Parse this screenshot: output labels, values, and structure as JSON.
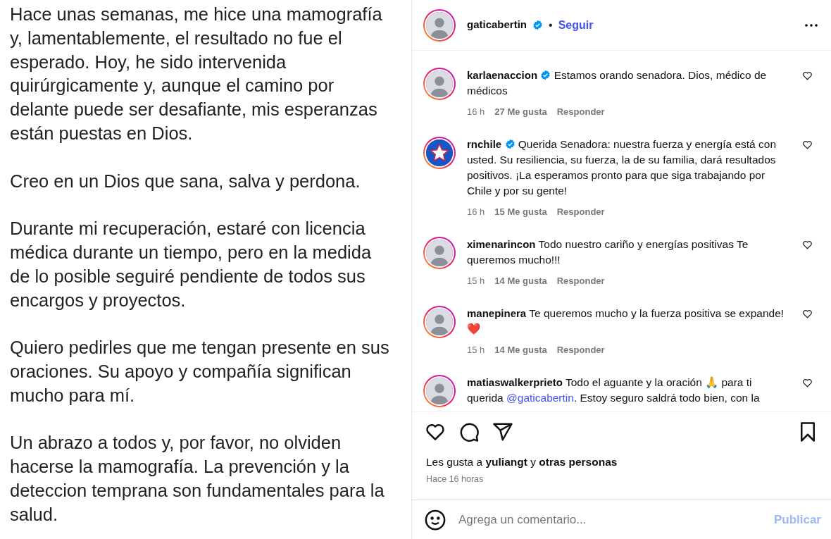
{
  "post_image": {
    "kind": "document",
    "paragraphs": [
      "Hace unas semanas, me hice una mamografía y, lamentablemente, el resultado no fue el esperado. Hoy, he sido intervenida quirúrgicamente y, aunque el camino por delante puede ser desafiante, mis esperanzas están puestas en Dios.",
      "Creo en un Dios que sana, salva y perdona.",
      "Durante mi recuperación, estaré con licencia médica durante un tiempo,  pero en la medida de lo posible seguiré pendiente de todos sus encargos y proyectos.",
      "Quiero pedirles que me tengan presente en sus oraciones. Su apoyo y compañía significan mucho para mí.",
      "Un abrazo a todos y, por favor, no olviden hacerse la mamografía. La prevención y la deteccion temprana son fundamentales para la salud."
    ]
  },
  "header": {
    "username": "gaticabertin",
    "verified": true,
    "separator": "•",
    "follow": "Seguir"
  },
  "comments": [
    {
      "username": "karlaenaccion",
      "verified": true,
      "kind": "photo",
      "text": "Estamos orando senadora. Dios, médico de médicos",
      "time": "16 h",
      "likes": "27 Me gusta",
      "reply": "Responder"
    },
    {
      "username": "rnchile",
      "verified": true,
      "kind": "logo",
      "text": "Querida Senadora: nuestra fuerza y energía está con usted. Su resiliencia, su fuerza, la de su familia, dará resultados positivos. ¡La esperamos pronto para que siga trabajando por Chile y por su gente!",
      "time": "16 h",
      "likes": "15 Me gusta",
      "reply": "Responder"
    },
    {
      "username": "ximenarincon",
      "verified": false,
      "kind": "photo",
      "text": "Todo nuestro cariño y energías positivas Te queremos mucho!!!",
      "time": "15 h",
      "likes": "14 Me gusta",
      "reply": "Responder"
    },
    {
      "username": "manepinera",
      "verified": false,
      "kind": "photo",
      "text": "Te queremos mucho y la fuerza positiva se expande! ❤️",
      "time": "15 h",
      "likes": "14 Me gusta",
      "reply": "Responder"
    },
    {
      "username": "matiaswalkerprieto",
      "verified": false,
      "kind": "photo",
      "text": "Todo el aguante y la oración 🙏 para ti querida",
      "mention": "@gaticabertin",
      "text_after": ". Estoy seguro saldrá todo bien, con la"
    }
  ],
  "likes_line": "Les gusta a **yuliangt** y **otras personas**",
  "posted": "Hace 16 horas",
  "comment_box": {
    "placeholder": "Agrega un comentario...",
    "submit": "Publicar"
  }
}
